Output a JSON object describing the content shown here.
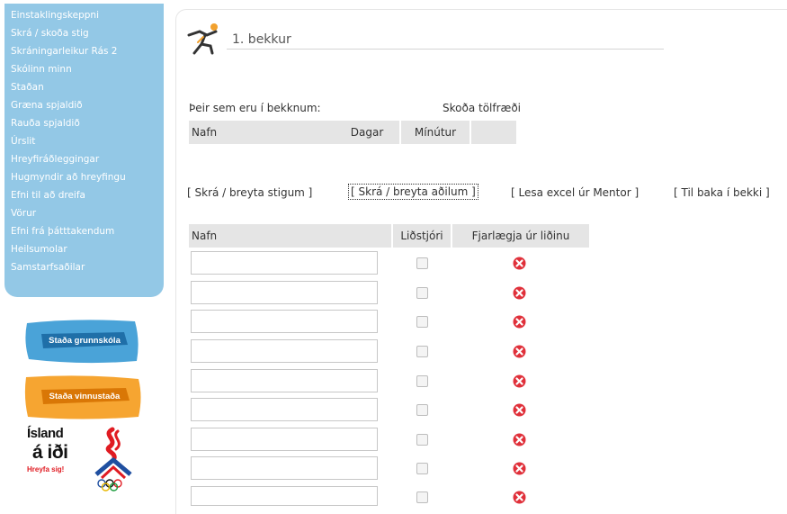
{
  "sidebar": {
    "items": [
      {
        "label": "Einstaklingskeppni"
      },
      {
        "label": "Skrá / skoða stig"
      },
      {
        "label": "Skráningarleikur Rás 2"
      },
      {
        "label": "Skólinn minn"
      },
      {
        "label": "Staðan"
      },
      {
        "label": "Græna spjaldið"
      },
      {
        "label": "Rauða spjaldið"
      },
      {
        "label": "Úrslit"
      },
      {
        "label": "Hreyfiráðleggingar"
      },
      {
        "label": "Hugmyndir að hreyfingu"
      },
      {
        "label": "Efni til að dreifa"
      },
      {
        "label": "Vörur"
      },
      {
        "label": "Efni frá þátttakendum"
      },
      {
        "label": "Heilsumolar"
      },
      {
        "label": "Samstarfsaðilar"
      }
    ],
    "promo_school": "Staða grunnskóla",
    "promo_work": "Staða vinnustaða",
    "logo_line1": "Ísland",
    "logo_line2": "á iði",
    "logo_line3": "Hreyfa sig!"
  },
  "colors": {
    "sidebar_bg": "#93c8e6",
    "promo_blue": "#4aa3d8",
    "promo_orange": "#f6a531",
    "delete_red": "#e0303a"
  },
  "page": {
    "title": "1. bekkur"
  },
  "members": {
    "intro": "Þeir sem eru í bekknum:",
    "stats_link": "Skoða tölfræði",
    "columns": [
      "Nafn",
      "Dagar",
      "Mínútur",
      ""
    ]
  },
  "actions": {
    "register_points": "[ Skrá / breyta stigum ]",
    "register_members": "[ Skrá / breyta aðilum ]",
    "read_excel": "[ Lesa excel úr Mentor ]",
    "back": "[ Til baka í bekki ]"
  },
  "roster": {
    "columns": [
      "Nafn",
      "Liðstjóri",
      "Fjarlægja úr liðinu"
    ],
    "rows": [
      {
        "name": "",
        "captain": false
      },
      {
        "name": "",
        "captain": false
      },
      {
        "name": "",
        "captain": false
      },
      {
        "name": "",
        "captain": false
      },
      {
        "name": "",
        "captain": false
      },
      {
        "name": "",
        "captain": false
      },
      {
        "name": "",
        "captain": false
      },
      {
        "name": "",
        "captain": false
      },
      {
        "name": "",
        "captain": false
      }
    ],
    "delete_icon": "delete-x-icon"
  }
}
